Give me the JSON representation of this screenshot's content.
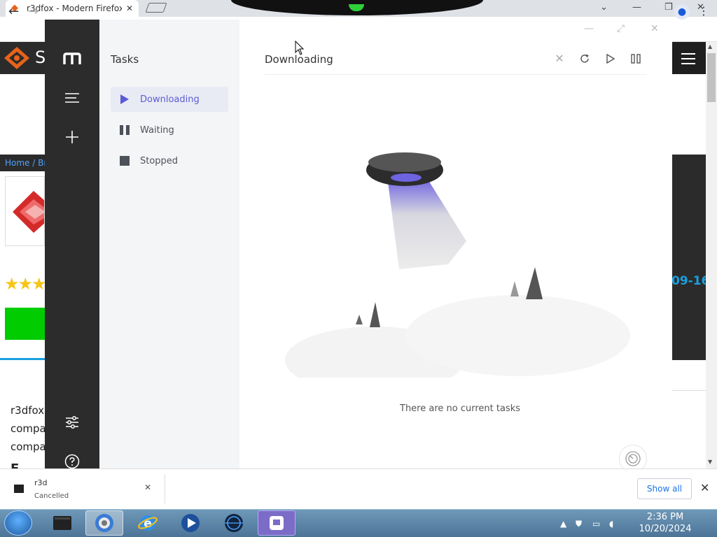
{
  "browser": {
    "tab_title": "r3dfox - Modern Firefox",
    "tab_close": "✕",
    "window_controls": [
      "⌄",
      "—",
      "❐",
      "✕"
    ],
    "back": "←",
    "forward": "→",
    "menu": "⋮"
  },
  "site": {
    "logo_letter": "S",
    "breadcrumb": "Home / Bro",
    "stars": "★★★",
    "date_fragment": "09-16",
    "text_lines": [
      "r3dfox",
      "compat",
      "compat",
      "F"
    ]
  },
  "app": {
    "sidebar_title": "Tasks",
    "sidebar_items": [
      {
        "label": "Downloading",
        "icon": "play-icon",
        "active": true
      },
      {
        "label": "Waiting",
        "icon": "pause-icon",
        "active": false
      },
      {
        "label": "Stopped",
        "icon": "stop-icon",
        "active": false
      }
    ],
    "main_title": "Downloading",
    "empty_text": "There are no current tasks",
    "accent_color": "#5b5bd6"
  },
  "download_bar": {
    "item_name": "r3d",
    "item_status": "Cancelled",
    "show_all": "Show all",
    "close": "✕"
  },
  "taskbar": {
    "time": "2:36 PM",
    "date": "10/20/2024"
  }
}
